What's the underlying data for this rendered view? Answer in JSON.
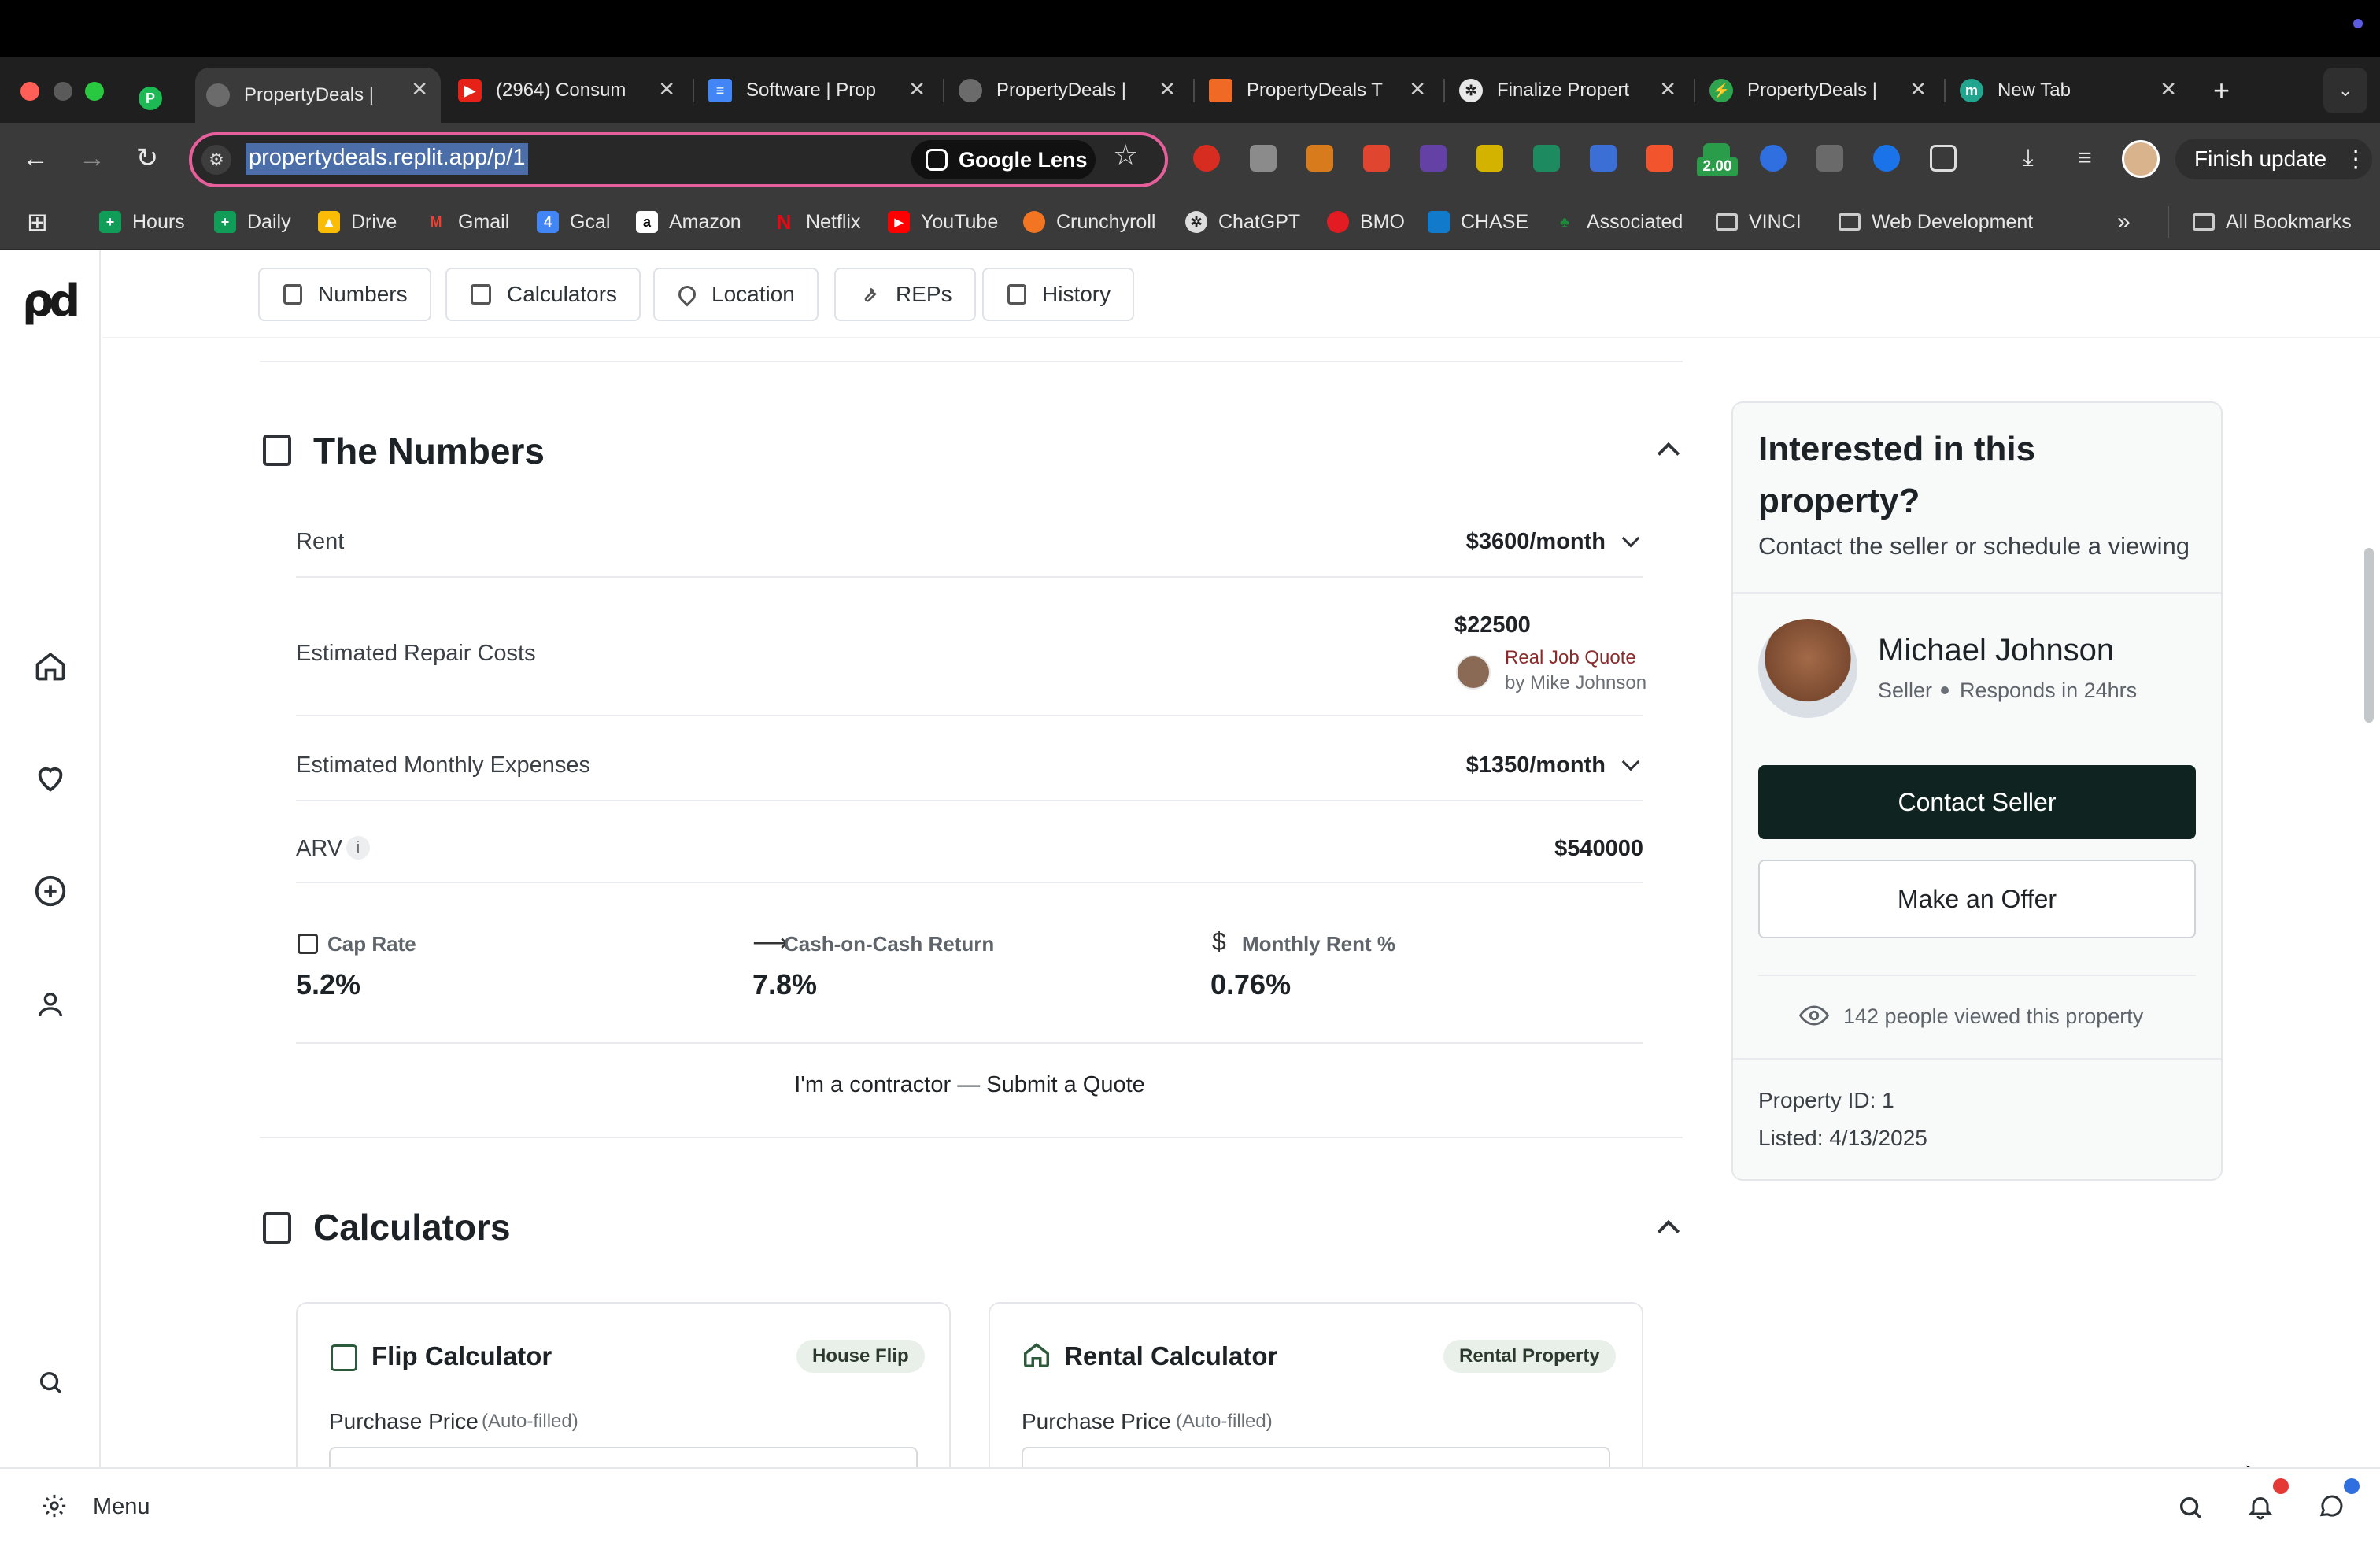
{
  "browser": {
    "tabs": [
      {
        "title": "PropertyDeals |",
        "favicon_color": "#6b6b6b"
      },
      {
        "title": "(2964) Consum",
        "favicon_color": "#e62117"
      },
      {
        "title": "Software | Prop",
        "favicon_color": "#4285f4"
      },
      {
        "title": "PropertyDeals |",
        "favicon_color": "#6b6b6b"
      },
      {
        "title": "PropertyDeals T",
        "favicon_color": "#f06a25"
      },
      {
        "title": "Finalize Propert",
        "favicon_color": "#e8e8e8"
      },
      {
        "title": "PropertyDeals |",
        "favicon_color": "#2ea44f"
      },
      {
        "title": "New Tab",
        "favicon_color": "#21a58f"
      }
    ],
    "url": "propertydeals.replit.app/p/1",
    "lens_label": "Google Lens",
    "finish_update": "Finish update",
    "bookmarks": [
      {
        "label": "Hours",
        "color": "#0f9d58"
      },
      {
        "label": "Daily",
        "color": "#0f9d58"
      },
      {
        "label": "Drive",
        "color": "#fbbc05"
      },
      {
        "label": "Gmail",
        "color": "#ea4335"
      },
      {
        "label": "Gcal",
        "color": "#4285f4"
      },
      {
        "label": "Amazon",
        "color": "#ffffff"
      },
      {
        "label": "Netflix",
        "color": "#e50914"
      },
      {
        "label": "YouTube",
        "color": "#ff0000"
      },
      {
        "label": "Crunchyroll",
        "color": "#f47521"
      },
      {
        "label": "ChatGPT",
        "color": "#dddddd"
      },
      {
        "label": "BMO",
        "color": "#e31b23"
      },
      {
        "label": "CHASE",
        "color": "#117aca"
      },
      {
        "label": "Associated",
        "color": "#1d8a3b"
      },
      {
        "label": "VINCI",
        "color": "#cccccc"
      },
      {
        "label": "Web Development",
        "color": "#cccccc"
      }
    ],
    "all_bookmarks": "All Bookmarks",
    "ext_badge": "2.00"
  },
  "subnav": {
    "items": [
      "Numbers",
      "Calculators",
      "Location",
      "REPs",
      "History"
    ]
  },
  "numbers": {
    "title": "The Numbers",
    "rows": {
      "rent_label": "Rent",
      "rent_value": "$3600/month",
      "repair_label": "Estimated Repair Costs",
      "repair_value": "$22500",
      "quote_link": "Real Job Quote",
      "quote_by": "by Mike Johnson",
      "expenses_label": "Estimated Monthly Expenses",
      "expenses_value": "$1350/month",
      "arv_label": "ARV",
      "arv_info": "i",
      "arv_value": "$540000"
    },
    "metrics": [
      {
        "label": "Cap Rate",
        "value": "5.2%"
      },
      {
        "label": "Cash-on-Cash Return",
        "value": "7.8%"
      },
      {
        "label": "Monthly Rent %",
        "value": "0.76%"
      }
    ],
    "contractor_cta": "I'm a contractor — Submit a Quote"
  },
  "calculators": {
    "title": "Calculators",
    "flip": {
      "title": "Flip Calculator",
      "badge": "House Flip",
      "field_label": "Purchase Price",
      "field_hint": "(Auto-filled)"
    },
    "rental": {
      "title": "Rental Calculator",
      "badge": "Rental Property",
      "field_label": "Purchase Price",
      "field_hint": "(Auto-filled)"
    }
  },
  "seller_card": {
    "heading": "Interested in this property?",
    "subheading": "Contact the seller or schedule a viewing",
    "name": "Michael Johnson",
    "role": "Seller",
    "response": "Responds in 24hrs",
    "contact_btn": "Contact Seller",
    "offer_btn": "Make an Offer",
    "views": "142 people viewed this property",
    "property_id": "Property ID: 1",
    "listed": "Listed: 4/13/2025"
  },
  "bottom_bar": {
    "menu_label": "Menu"
  }
}
